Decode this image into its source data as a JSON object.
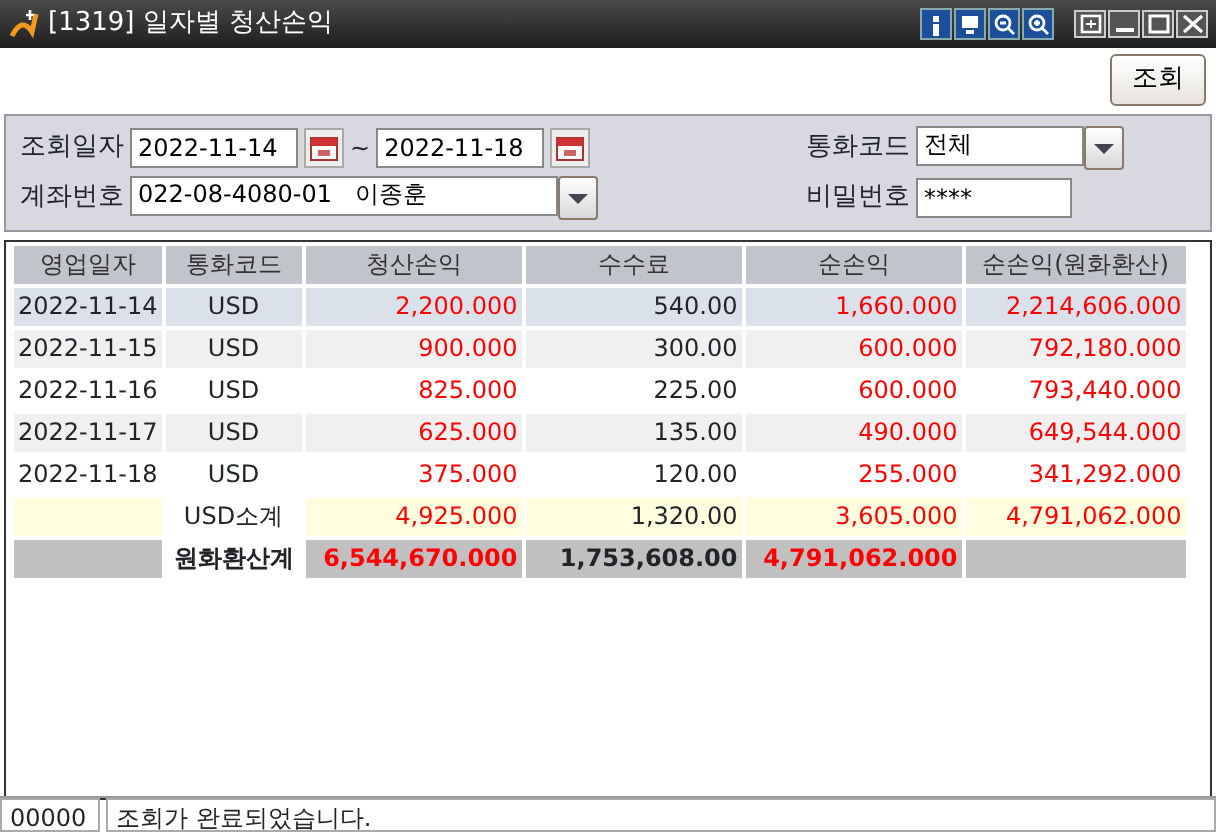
{
  "window": {
    "title": "[1319] 일자별 청산손익"
  },
  "toolbar": {
    "search_button": "조회"
  },
  "filters": {
    "date_label": "조회일자",
    "date_from": "2022-11-14",
    "date_separator": "~",
    "date_to": "2022-11-18",
    "currency_label": "통화코드",
    "currency_value": "전체",
    "account_label": "계좌번호",
    "account_value": "022-08-4080-01   이종훈",
    "password_label": "비밀번호",
    "password_value": "****"
  },
  "table": {
    "columns": [
      "영업일자",
      "통화코드",
      "청산손익",
      "수수료",
      "순손익",
      "순손익(원화환산)"
    ],
    "rows": [
      {
        "kind": "data",
        "selected": true,
        "cells": [
          "2022-11-14",
          "USD",
          "2,200.000",
          "540.00",
          "1,660.000",
          "2,214,606.000"
        ]
      },
      {
        "kind": "data",
        "selected": false,
        "cells": [
          "2022-11-15",
          "USD",
          "900.000",
          "300.00",
          "600.000",
          "792,180.000"
        ]
      },
      {
        "kind": "data",
        "selected": false,
        "cells": [
          "2022-11-16",
          "USD",
          "825.000",
          "225.00",
          "600.000",
          "793,440.000"
        ]
      },
      {
        "kind": "data",
        "selected": false,
        "cells": [
          "2022-11-17",
          "USD",
          "625.000",
          "135.00",
          "490.000",
          "649,544.000"
        ]
      },
      {
        "kind": "data",
        "selected": false,
        "cells": [
          "2022-11-18",
          "USD",
          "375.000",
          "120.00",
          "255.000",
          "341,292.000"
        ]
      },
      {
        "kind": "subtotal",
        "selected": false,
        "cells": [
          "",
          "USD소계",
          "4,925.000",
          "1,320.00",
          "3,605.000",
          "4,791,062.000"
        ]
      },
      {
        "kind": "total",
        "selected": false,
        "cells": [
          "",
          "원화환산계",
          "6,544,670.000",
          "1,753,608.00",
          "4,791,062.000",
          ""
        ]
      }
    ]
  },
  "status_bar": {
    "code": "00000",
    "message": "조회가 완료되었습니다."
  }
}
